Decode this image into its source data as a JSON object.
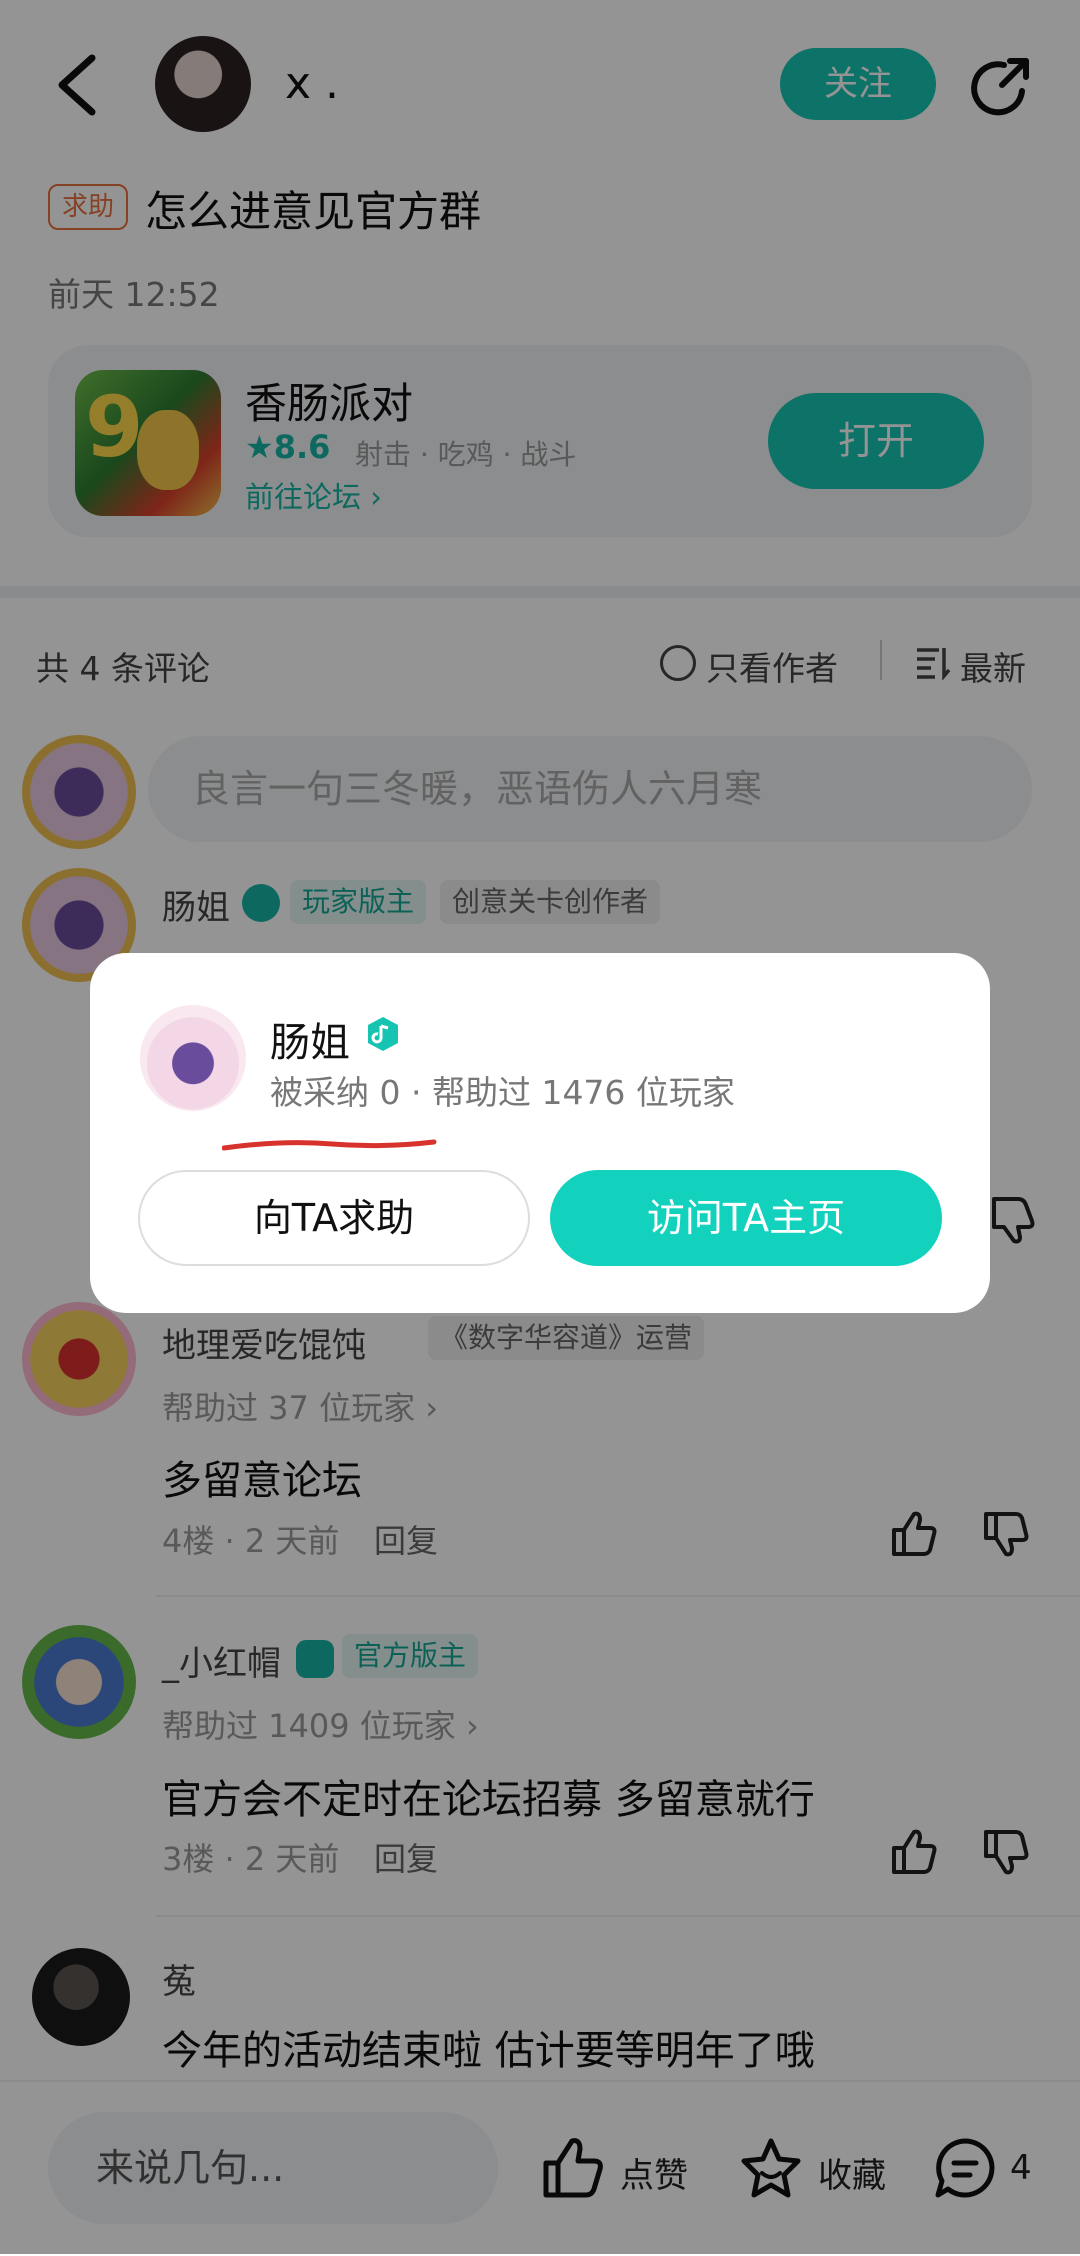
{
  "header": {
    "username": "x .",
    "follow_label": "关注"
  },
  "post": {
    "tag": "求助",
    "title": "怎么进意见官方群",
    "time": "前天 12:52"
  },
  "game_card": {
    "name": "香肠派对",
    "rating": "★8.6",
    "genres": "射击 · 吃鸡 · 战斗",
    "forum_link": "前往论坛 ›",
    "open_label": "打开"
  },
  "comments_header": {
    "count": "共 4 条评论",
    "only_author": "只看作者",
    "sort": "最新"
  },
  "comment_input_placeholder": "良言一句三冬暖，恶语伤人六月寒",
  "comments": [
    {
      "name": "肠姐",
      "badges": [
        "玩家版主",
        "创意关卡创作者"
      ]
    },
    {
      "name": "地理爱吃馄饨",
      "badges": [
        "《数字华容道》运营"
      ],
      "help": "帮助过 37 位玩家 ›",
      "text": "多留意论坛",
      "floor": "4楼 · 2 天前",
      "reply": "回复"
    },
    {
      "name": "_小红帽",
      "badges": [
        "官方版主"
      ],
      "help": "帮助过 1409 位玩家 ›",
      "text": "官方会不定时在论坛招募  多留意就行",
      "floor": "3楼 · 2 天前",
      "reply": "回复"
    },
    {
      "name": "菟",
      "text": "今年的活动结束啦 估计要等明年了哦"
    }
  ],
  "bottom_bar": {
    "input_placeholder": "来说几句...",
    "like_label": "点赞",
    "favorite_label": "收藏",
    "comment_count": "4"
  },
  "popup": {
    "name": "肠姐",
    "stats": "被采纳 0 · 帮助过 1476 位玩家",
    "ask_label": "向TA求助",
    "visit_label": "访问TA主页"
  },
  "colors": {
    "accent": "#17c4b1",
    "tag_orange": "#e9703f",
    "underline_red": "#d8322c"
  },
  "icons": [
    "back-icon",
    "share-icon",
    "star-icon",
    "circle-icon",
    "sort-icon",
    "verified-note-icon",
    "like-icon",
    "dislike-icon",
    "favorite-star-icon",
    "comment-icon"
  ]
}
